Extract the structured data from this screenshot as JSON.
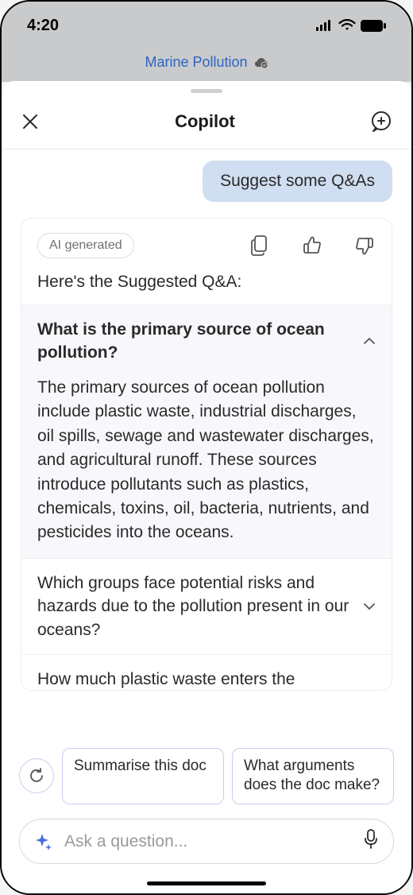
{
  "status": {
    "time": "4:20"
  },
  "doc": {
    "title": "Marine Pollution"
  },
  "copilot": {
    "title": "Copilot"
  },
  "conversation": {
    "userMessage": "Suggest some Q&As",
    "aiBadge": "AI generated",
    "aiIntro": "Here's the Suggested Q&A:",
    "qaItems": [
      {
        "question": "What is the primary source of ocean pollution?",
        "answer": "The primary sources of ocean pollution include plastic waste, industrial discharges, oil spills, sewage and wastewater discharges, and agricultural runoff. These sources introduce pollutants such as plastics, chemicals, toxins, oil, bacteria, nutrients, and pesticides into the oceans.",
        "expanded": true
      },
      {
        "question": "Which groups face potential risks and hazards due to the pollution present in our oceans?",
        "expanded": false
      },
      {
        "question": "How much plastic waste enters the",
        "expanded": false,
        "cutoff": true
      }
    ]
  },
  "suggestions": {
    "chips": [
      "Summarise this doc",
      "What arguments does the doc make?"
    ]
  },
  "input": {
    "placeholder": "Ask a question..."
  }
}
